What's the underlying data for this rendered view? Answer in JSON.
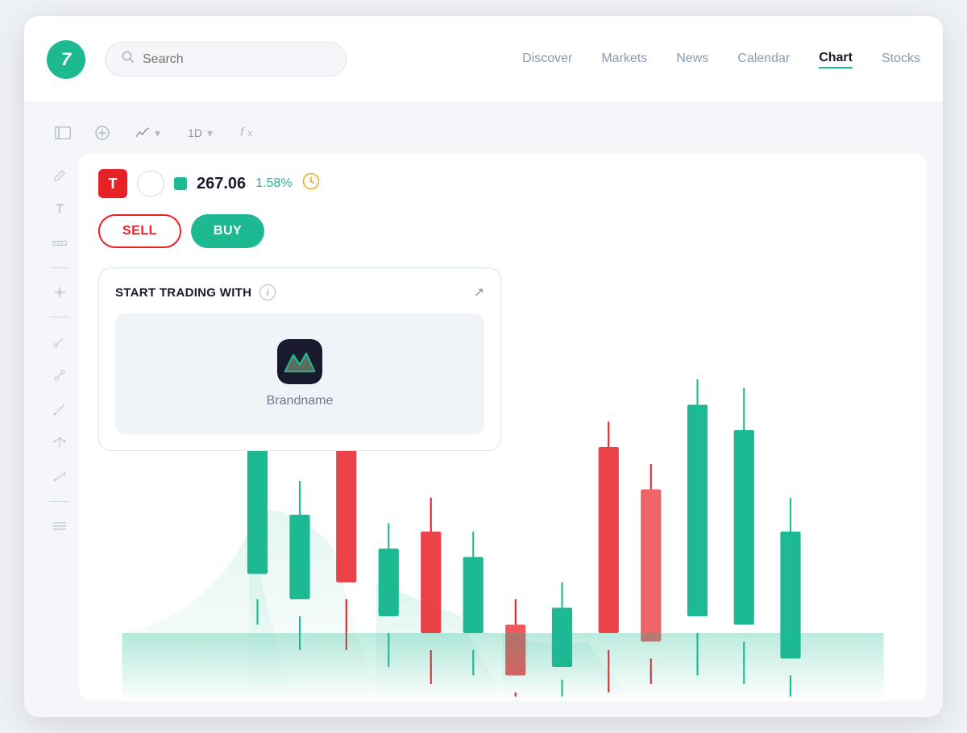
{
  "header": {
    "logo_text": "7",
    "search_placeholder": "Search",
    "nav_items": [
      {
        "label": "Discover",
        "active": false
      },
      {
        "label": "Markets",
        "active": false
      },
      {
        "label": "News",
        "active": false
      },
      {
        "label": "Calendar",
        "active": false
      },
      {
        "label": "Chart",
        "active": true
      },
      {
        "label": "Stocks",
        "active": false,
        "partial": true
      }
    ]
  },
  "toolbar": {
    "interval": "1D",
    "chart_type": "~",
    "fx_label": "fx"
  },
  "stock": {
    "symbol": "T",
    "price": "267.06",
    "change": "1.58%",
    "sell_label": "SELL",
    "buy_label": "BUY"
  },
  "trading_card": {
    "title": "START TRADING WITH",
    "brand_name": "Brandname"
  },
  "colors": {
    "green": "#1db992",
    "red": "#e82127",
    "accent": "#1db992"
  }
}
